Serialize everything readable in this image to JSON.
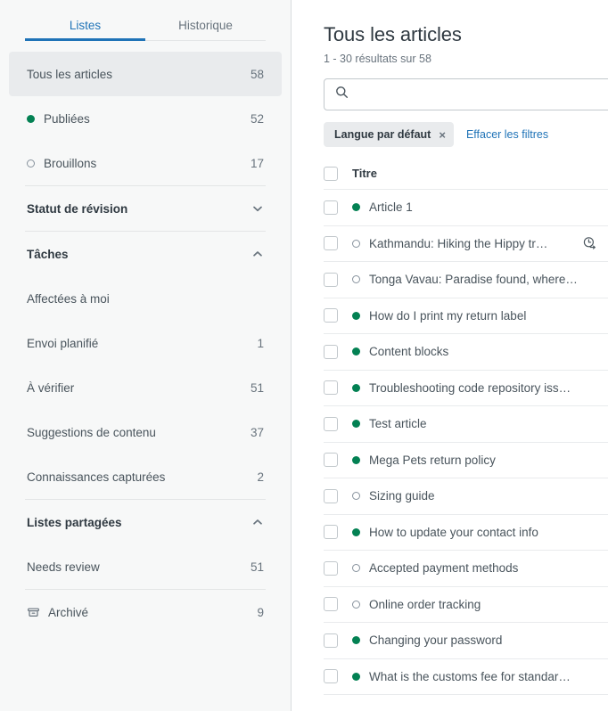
{
  "colors": {
    "accent_blue": "#1f73b7",
    "published_green": "#038153",
    "sidebar_bg": "#f7f8f8",
    "selected_bg": "#e9ebed",
    "text_dark": "#2f3941",
    "text_muted": "#68737d"
  },
  "sidebar": {
    "tabs": [
      {
        "label": "Listes",
        "active": true
      },
      {
        "label": "Historique",
        "active": false
      }
    ],
    "groups": [
      {
        "type": "items",
        "items": [
          {
            "label": "Tous les articles",
            "count": "58",
            "selected": true,
            "dot": "none"
          },
          {
            "label": "Publiées",
            "count": "52",
            "selected": false,
            "dot": "published"
          },
          {
            "label": "Brouillons",
            "count": "17",
            "selected": false,
            "dot": "draft"
          }
        ]
      },
      {
        "type": "section",
        "title": "Statut de révision",
        "expanded": false,
        "chevron": "chevron-down-icon",
        "items": []
      },
      {
        "type": "section",
        "title": "Tâches",
        "expanded": true,
        "chevron": "chevron-up-icon",
        "items": [
          {
            "label": "Affectées à moi",
            "count": ""
          },
          {
            "label": "Envoi planifié",
            "count": "1"
          },
          {
            "label": "À vérifier",
            "count": "51"
          },
          {
            "label": "Suggestions de contenu",
            "count": "37"
          },
          {
            "label": "Connaissances capturées",
            "count": "2"
          }
        ]
      },
      {
        "type": "section",
        "title": "Listes partagées",
        "expanded": true,
        "chevron": "chevron-up-icon",
        "items": [
          {
            "label": "Needs review",
            "count": "51"
          }
        ]
      },
      {
        "type": "items",
        "items": [
          {
            "label": "Archivé",
            "count": "9",
            "selected": false,
            "dot": "none",
            "icon": "archive-icon"
          }
        ]
      }
    ]
  },
  "main": {
    "title": "Tous les articles",
    "result_count": "1 - 30 résultats sur 58",
    "search": {
      "value": "",
      "placeholder": ""
    },
    "filters": {
      "chip_label": "Langue par défaut",
      "chip_remove": "×",
      "clear_label": "Effacer les filtres"
    },
    "table": {
      "header": {
        "title": "Titre"
      },
      "rows": [
        {
          "title": "Article 1",
          "status": "published",
          "scheduled": false
        },
        {
          "title": "Kathmandu: Hiking the Hippy tr…",
          "status": "draft",
          "scheduled": true
        },
        {
          "title": "Tonga Vavau: Paradise found, where…",
          "status": "draft",
          "scheduled": false
        },
        {
          "title": "How do I print my return label",
          "status": "published",
          "scheduled": false
        },
        {
          "title": "Content blocks",
          "status": "published",
          "scheduled": false
        },
        {
          "title": "Troubleshooting code repository iss…",
          "status": "published",
          "scheduled": false
        },
        {
          "title": "Test article",
          "status": "published",
          "scheduled": false
        },
        {
          "title": "Mega Pets return policy",
          "status": "published",
          "scheduled": false
        },
        {
          "title": "Sizing guide",
          "status": "draft",
          "scheduled": false
        },
        {
          "title": "How to update your contact info",
          "status": "published",
          "scheduled": false
        },
        {
          "title": "Accepted payment methods",
          "status": "draft",
          "scheduled": false
        },
        {
          "title": "Online order tracking",
          "status": "draft",
          "scheduled": false
        },
        {
          "title": "Changing your password",
          "status": "published",
          "scheduled": false
        },
        {
          "title": "What is the customs fee for standar…",
          "status": "published",
          "scheduled": false
        }
      ]
    }
  }
}
